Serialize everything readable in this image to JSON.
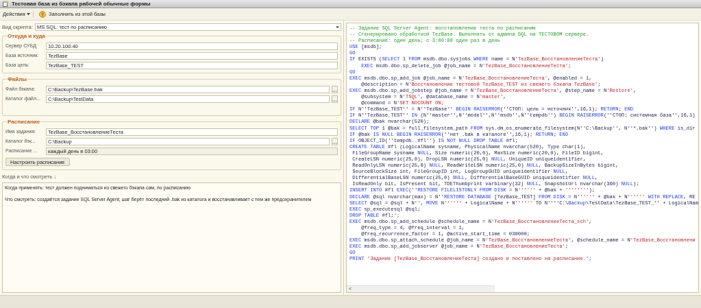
{
  "window": {
    "title": "Тестовая база из бэкапа рабочей обычные формы"
  },
  "toolbar": {
    "actions": "Действия",
    "fill_button": "Заполнить из этой базы"
  },
  "script_type": {
    "label": "Вид скрипта:",
    "value": "MS SQL: тест по расписанию"
  },
  "groups": [
    {
      "title": "Откуда и куда",
      "fields": [
        {
          "label": "Сервер СУБД:",
          "value": "10.20.100.40",
          "browse": false,
          "disabled": false
        },
        {
          "label": "База источник:",
          "value": "TezBase",
          "browse": false,
          "disabled": false
        },
        {
          "label": "База цель:",
          "value": "TezBase_TEST",
          "browse": false,
          "disabled": false
        }
      ]
    },
    {
      "title": "Файлы",
      "fields": [
        {
          "label": "Файл бэкапа:",
          "value": "C:\\Backup\\TezBase.bak",
          "browse": true,
          "disabled": false
        },
        {
          "label": "Каталог файл...",
          "value": "C:\\Backup\\TestData",
          "browse": true,
          "disabled": false
        }
      ]
    },
    {
      "title": "Расписание",
      "fields": [
        {
          "label": "Имя задания:",
          "value": "TezBase_ВосстановлениеТеста",
          "browse": false,
          "disabled": false
        },
        {
          "label": "Каталог бэк...",
          "value": "C:\\Backup",
          "browse": true,
          "disabled": false
        },
        {
          "label": "Расписание ...",
          "value": "каждый день в 03:00",
          "browse": false,
          "disabled": true
        }
      ],
      "button": "Настроить расписание"
    }
  ],
  "notes": {
    "label": "Когда и что смотреть ↓",
    "lines": [
      "Когда применять: тест должен подниматься из свежего бэкапа сам, по расписанию",
      "Что смотреть: создаётся задание SQL Server Agent; шаг берёт последний .bak из каталога и восстанавливает с тем же предохранителем"
    ]
  },
  "code_lines": [
    [
      {
        "kind": "comment",
        "text": "-- Задание SQL Server Agent: восстановление теста по расписанию"
      }
    ],
    [
      {
        "kind": "comment",
        "text": "-- Сгенерировано обработкой TezBase. Выполнять от админа SQL на ТЕСТОВОМ сервере."
      }
    ],
    [
      {
        "kind": "comment",
        "text": "-- Расписание: один день; с 3:00:00 один раз в день"
      }
    ],
    [
      {
        "kind": "keyword",
        "text": "USE"
      },
      {
        "kind": "plain",
        "text": " [msdb];"
      }
    ],
    [
      {
        "kind": "keyword",
        "text": "GO"
      }
    ],
    [
      {
        "kind": "keyword",
        "text": "IF"
      },
      {
        "kind": "plain",
        "text": " EXISTS ("
      },
      {
        "kind": "keyword",
        "text": "SELECT"
      },
      {
        "kind": "plain",
        "text": " 1 "
      },
      {
        "kind": "keyword",
        "text": "FROM"
      },
      {
        "kind": "plain",
        "text": " msdb.dbo.sysjobs "
      },
      {
        "kind": "keyword",
        "text": "WHERE"
      },
      {
        "kind": "plain",
        "text": " name = N"
      },
      {
        "kind": "string",
        "text": "'TezBase_ВосстановлениеТеста'"
      },
      {
        "kind": "plain",
        "text": ")"
      }
    ],
    [
      {
        "kind": "keyword",
        "text": "    EXEC"
      },
      {
        "kind": "plain",
        "text": " msdb.dbo.sp_delete_job @job_name = N"
      },
      {
        "kind": "string",
        "text": "'TezBase_ВосстановлениеТеста'"
      },
      {
        "kind": "plain",
        "text": ";"
      }
    ],
    [
      {
        "kind": "keyword",
        "text": "GO"
      }
    ],
    [
      {
        "kind": "keyword",
        "text": "EXEC"
      },
      {
        "kind": "plain",
        "text": " msdb.dbo.sp_add_job @job_name = N"
      },
      {
        "kind": "string",
        "text": "'TezBase_ВосстановлениеТеста'"
      },
      {
        "kind": "plain",
        "text": ", @enabled = 1,"
      }
    ],
    [
      {
        "kind": "plain",
        "text": "    @description = N"
      },
      {
        "kind": "string",
        "text": "'Восстановление тестовой TezBase_TEST из свежего бэкапа TezBase'"
      },
      {
        "kind": "plain",
        "text": ";"
      }
    ],
    [
      {
        "kind": "keyword",
        "text": "EXEC"
      },
      {
        "kind": "plain",
        "text": " msdb.dbo.sp_add_jobstep @job_name = N"
      },
      {
        "kind": "string",
        "text": "'TezBase_ВосстановлениеТеста'"
      },
      {
        "kind": "plain",
        "text": ", @step_name = N"
      },
      {
        "kind": "string",
        "text": "'Restore'"
      },
      {
        "kind": "plain",
        "text": ","
      }
    ],
    [
      {
        "kind": "plain",
        "text": "    @subsystem = N"
      },
      {
        "kind": "string",
        "text": "'TSQL'"
      },
      {
        "kind": "plain",
        "text": ", @database_name = N"
      },
      {
        "kind": "string",
        "text": "'master'"
      },
      {
        "kind": "plain",
        "text": ","
      }
    ],
    [
      {
        "kind": "plain",
        "text": "    @command = N"
      },
      {
        "kind": "string",
        "text": "'SET NOCOUNT ON;"
      }
    ],
    [
      {
        "kind": "keyword",
        "text": "IF"
      },
      {
        "kind": "plain",
        "text": " N''TezBase_TEST'' = N''TezBase'' "
      },
      {
        "kind": "keyword",
        "text": "BEGIN RAISERROR"
      },
      {
        "kind": "plain",
        "text": "(''СТОП: цель = источник'',16,1); "
      },
      {
        "kind": "keyword",
        "text": "RETURN"
      },
      {
        "kind": "plain",
        "text": "; "
      },
      {
        "kind": "keyword",
        "text": "END"
      }
    ],
    [
      {
        "kind": "keyword",
        "text": "IF"
      },
      {
        "kind": "plain",
        "text": " N''TezBase_TEST'' "
      },
      {
        "kind": "keyword",
        "text": "IN"
      },
      {
        "kind": "plain",
        "text": " (N''master'',N''model'',N''msdb'',N''tempdb'') "
      },
      {
        "kind": "keyword",
        "text": "BEGIN RAISERROR"
      },
      {
        "kind": "plain",
        "text": "(''СТОП: системная база'',16,1)"
      }
    ],
    [
      {
        "kind": "keyword",
        "text": "DECLARE"
      },
      {
        "kind": "plain",
        "text": " @bak nvarchar(520);"
      }
    ],
    [
      {
        "kind": "keyword",
        "text": "SELECT TOP"
      },
      {
        "kind": "plain",
        "text": " 1 @bak = full_filesystem_path "
      },
      {
        "kind": "keyword",
        "text": "FROM"
      },
      {
        "kind": "plain",
        "text": " sys.dm_os_enumerate_filesystem(N''C:\\Backup'', N''*.bak'') "
      },
      {
        "kind": "keyword",
        "text": "WHERE"
      },
      {
        "kind": "plain",
        "text": " is_dir"
      }
    ],
    [
      {
        "kind": "keyword",
        "text": "IF"
      },
      {
        "kind": "plain",
        "text": " @bak "
      },
      {
        "kind": "keyword",
        "text": "IS NULL BEGIN RAISERROR"
      },
      {
        "kind": "plain",
        "text": "(''нет .bak в каталоге'',16,1); "
      },
      {
        "kind": "keyword",
        "text": "RETURN"
      },
      {
        "kind": "plain",
        "text": "; "
      },
      {
        "kind": "keyword",
        "text": "END"
      }
    ],
    [
      {
        "kind": "keyword",
        "text": "IF"
      },
      {
        "kind": "plain",
        "text": " OBJECT_ID(''tempdb..#fl'') "
      },
      {
        "kind": "keyword",
        "text": "IS NOT NULL DROP TABLE"
      },
      {
        "kind": "plain",
        "text": " #fl;"
      }
    ],
    [
      {
        "kind": "keyword",
        "text": "CREATE TABLE"
      },
      {
        "kind": "plain",
        "text": " #fl (LogicalName sysname, PhysicalName nvarchar(520), Type char(1),"
      }
    ],
    [
      {
        "kind": "plain",
        "text": " FileGroupName sysname "
      },
      {
        "kind": "keyword",
        "text": "NULL"
      },
      {
        "kind": "plain",
        "text": ", Size numeric(20,0), MaxSize numeric(20,0), FileID bigint,"
      }
    ],
    [
      {
        "kind": "plain",
        "text": " CreateLSN numeric(25,0), DropLSN numeric(25,0) "
      },
      {
        "kind": "keyword",
        "text": "NULL"
      },
      {
        "kind": "plain",
        "text": ", UniqueID uniqueidentifier,"
      }
    ],
    [
      {
        "kind": "plain",
        "text": " ReadOnlyLSN numeric(25,0) "
      },
      {
        "kind": "keyword",
        "text": "NULL"
      },
      {
        "kind": "plain",
        "text": ", ReadWriteLSN numeric(25,0) "
      },
      {
        "kind": "keyword",
        "text": "NULL"
      },
      {
        "kind": "plain",
        "text": ", BackupSizeInBytes bigint,"
      }
    ],
    [
      {
        "kind": "plain",
        "text": " SourceBlockSize int, FileGroupID int, LogGroupGUID uniqueidentifier "
      },
      {
        "kind": "keyword",
        "text": "NULL"
      },
      {
        "kind": "plain",
        "text": ","
      }
    ],
    [
      {
        "kind": "plain",
        "text": " DifferentialBaseLSN numeric(25,0) "
      },
      {
        "kind": "keyword",
        "text": "NULL"
      },
      {
        "kind": "plain",
        "text": ", DifferentialBaseGUID uniqueidentifier "
      },
      {
        "kind": "keyword",
        "text": "NULL"
      },
      {
        "kind": "plain",
        "text": ","
      }
    ],
    [
      {
        "kind": "plain",
        "text": " IsReadOnly bit, IsPresent bit, TDEThumbprint varbinary(32) "
      },
      {
        "kind": "keyword",
        "text": "NULL"
      },
      {
        "kind": "plain",
        "text": ", SnapshotUrl nvarchar(360) "
      },
      {
        "kind": "keyword",
        "text": "NULL"
      },
      {
        "kind": "plain",
        "text": ");"
      }
    ],
    [
      {
        "kind": "keyword",
        "text": "INSERT INTO"
      },
      {
        "kind": "plain",
        "text": " #fl "
      },
      {
        "kind": "keyword",
        "text": "EXEC"
      },
      {
        "kind": "plain",
        "text": "(''"
      },
      {
        "kind": "keyword",
        "text": "RESTORE FILELISTONLY FROM DISK"
      },
      {
        "kind": "plain",
        "text": " = N"
      },
      {
        "kind": "string",
        "text": "''''''"
      },
      {
        "kind": "plain",
        "text": " + @bak + "
      },
      {
        "kind": "string",
        "text": "''''''''"
      },
      {
        "kind": "plain",
        "text": ");"
      }
    ],
    [
      {
        "kind": "keyword",
        "text": "DECLARE"
      },
      {
        "kind": "plain",
        "text": " @sql nvarchar(max) = N''"
      },
      {
        "kind": "keyword",
        "text": "RESTORE DATABASE"
      },
      {
        "kind": "plain",
        "text": " [TezBase_TEST] "
      },
      {
        "kind": "keyword",
        "text": "FROM DISK"
      },
      {
        "kind": "plain",
        "text": " = N"
      },
      {
        "kind": "string",
        "text": "''''''"
      },
      {
        "kind": "plain",
        "text": " + @bak + N"
      },
      {
        "kind": "string",
        "text": "'''''' "
      },
      {
        "kind": "keyword",
        "text": "WITH REPLACE"
      },
      {
        "kind": "plain",
        "text": ", RE"
      }
    ],
    [
      {
        "kind": "keyword",
        "text": "SELECT"
      },
      {
        "kind": "plain",
        "text": " @sql = @sql + N'', "
      },
      {
        "kind": "keyword",
        "text": "MOVE"
      },
      {
        "kind": "plain",
        "text": " N"
      },
      {
        "kind": "string",
        "text": "''''''"
      },
      {
        "kind": "plain",
        "text": " + LogicalName + N"
      },
      {
        "kind": "string",
        "text": "''''''"
      },
      {
        "kind": "plain",
        "text": " TO N''''C:\\"
      },
      {
        "kind": "keyword",
        "text": "Backup"
      },
      {
        "kind": "plain",
        "text": "\\TestData\\TezBase_TEST_'' + LogicalNam"
      }
    ],
    [
      {
        "kind": "keyword",
        "text": "EXEC"
      },
      {
        "kind": "plain",
        "text": " sp_executesql @sql;"
      }
    ],
    [
      {
        "kind": "keyword",
        "text": "DROP TABLE"
      },
      {
        "kind": "plain",
        "text": " #fl;"
      },
      {
        "kind": "string",
        "text": "';"
      }
    ],
    [
      {
        "kind": "keyword",
        "text": "EXEC"
      },
      {
        "kind": "plain",
        "text": " msdb.dbo.sp_add_schedule @schedule_name = N"
      },
      {
        "kind": "string",
        "text": "'TezBase_ВосстановлениеТеста_sch'"
      },
      {
        "kind": "plain",
        "text": ","
      }
    ],
    [
      {
        "kind": "plain",
        "text": "    @freq_type = 4, @freq_interval = 1,"
      }
    ],
    [
      {
        "kind": "plain",
        "text": "    @freq_recurrence_factor = 1, @active_start_time = 030000;"
      }
    ],
    [
      {
        "kind": "keyword",
        "text": "EXEC"
      },
      {
        "kind": "plain",
        "text": " msdb.dbo.sp_attach_schedule @job_name = N"
      },
      {
        "kind": "string",
        "text": "'TezBase_ВосстановлениеТеста'"
      },
      {
        "kind": "plain",
        "text": ", @schedule_name = N"
      },
      {
        "kind": "string",
        "text": "'TezBase_Восстановлени"
      }
    ],
    [
      {
        "kind": "keyword",
        "text": "EXEC"
      },
      {
        "kind": "plain",
        "text": " msdb.dbo.sp_add_jobserver @job_name = N"
      },
      {
        "kind": "string",
        "text": "'TezBase_ВосстановлениеТеста'"
      },
      {
        "kind": "plain",
        "text": ";"
      }
    ],
    [
      {
        "kind": "keyword",
        "text": "GO"
      }
    ],
    [
      {
        "kind": "keyword",
        "text": "PRINT"
      },
      {
        "kind": "string",
        "text": " 'Задание [TezBase_ВосстановлениеТеста] создано и поставлено на расписание.'"
      },
      {
        "kind": "plain",
        "text": ";"
      }
    ]
  ],
  "scroll_left": "<"
}
